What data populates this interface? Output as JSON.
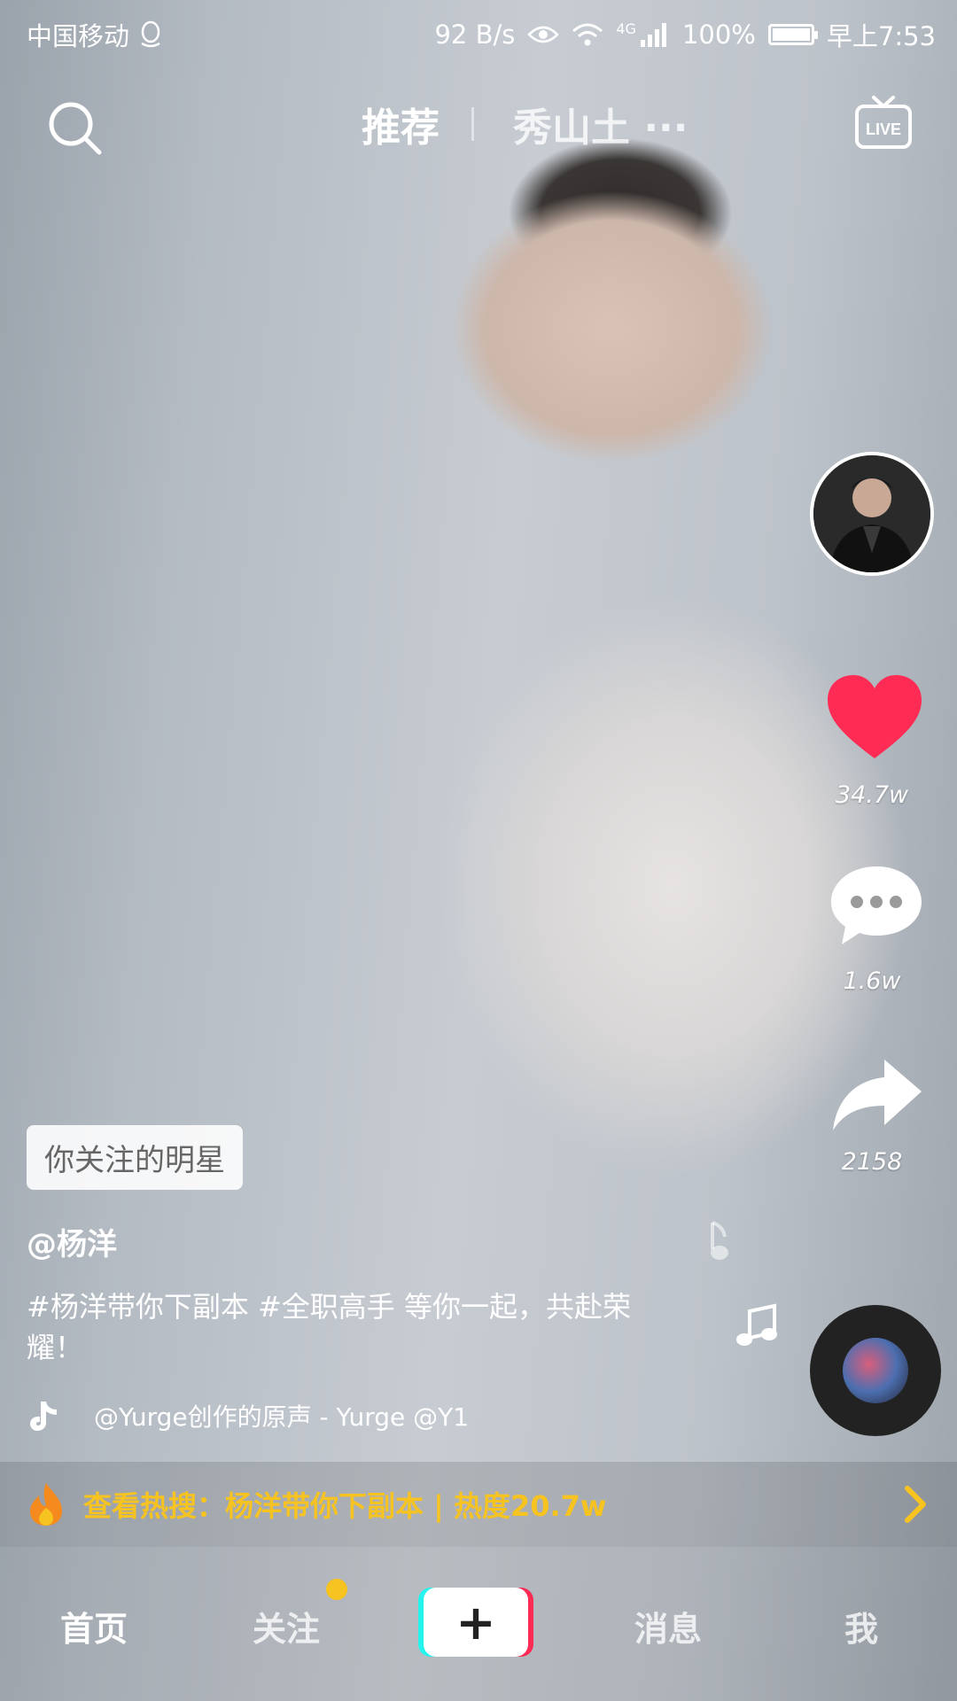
{
  "status_bar": {
    "carrier": "中国移动",
    "net_speed": "92 B/s",
    "network_type": "4G",
    "battery": "100%",
    "battery_level": 1.0,
    "time": "早上7:53"
  },
  "top_nav": {
    "tab_recommend": "推荐",
    "tab_location": "秀山土 ···",
    "live_label": "LIVE"
  },
  "actions": {
    "like_count": "34.7w",
    "comment_count": "1.6w",
    "share_count": "2158",
    "like_color": "#fe2c55"
  },
  "video_info": {
    "follow_tag": "你关注的明星",
    "author": "@杨洋",
    "description": "#杨洋带你下副本  #全职高手 等你一起，共赴荣耀！",
    "music": "@Yurge创作的原声 - Yurge    @Y1"
  },
  "hot_search": {
    "text": "查看热搜：杨洋带你下副本 | 热度20.7w",
    "color": "#f6c321"
  },
  "bottom_nav": {
    "home": "首页",
    "follow": "关注",
    "plus": "+",
    "messages": "消息",
    "me": "我"
  }
}
